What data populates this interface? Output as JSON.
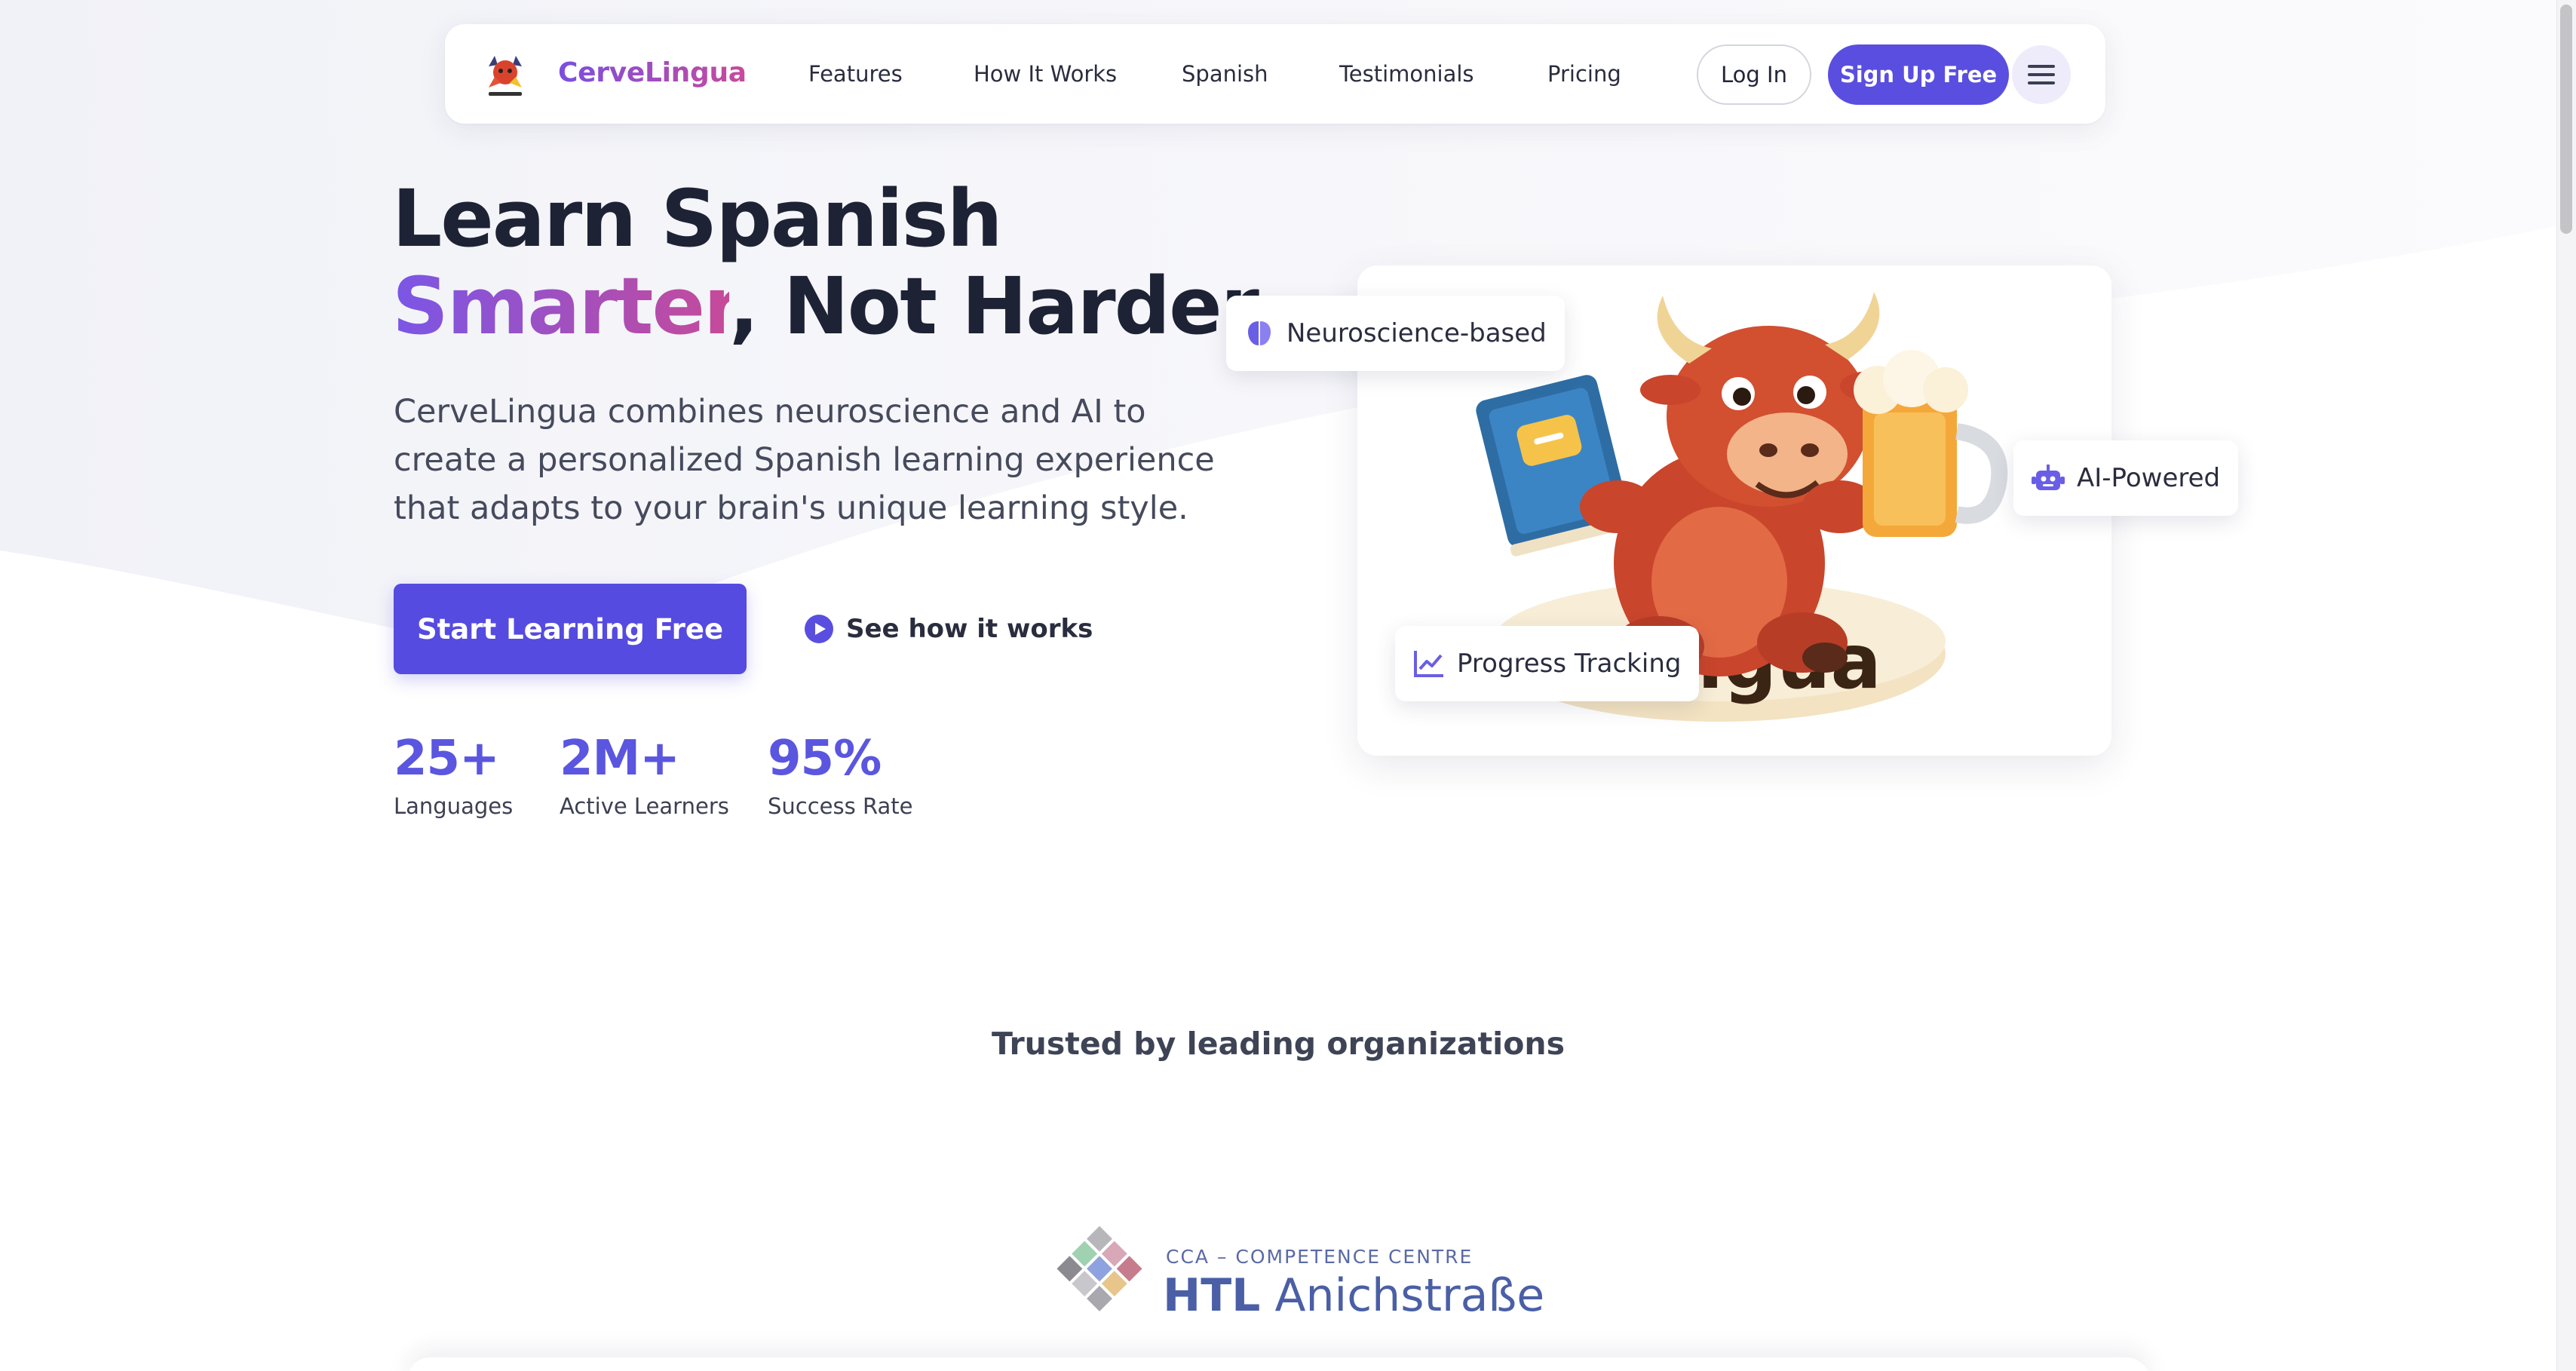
{
  "brand": {
    "name": "CerveLingua",
    "colors": {
      "primary": "#554be0",
      "gradient_start": "#7a56e6",
      "gradient_end": "#c64a9a"
    }
  },
  "nav": {
    "links": [
      "Features",
      "How It Works",
      "Spanish",
      "Testimonials",
      "Pricing"
    ],
    "login_label": "Log In",
    "signup_label": "Sign Up Free",
    "menu_icon": "hamburger-icon"
  },
  "hero": {
    "title_line1": "Learn Spanish",
    "title_accent": "Smarter",
    "title_rest": ", Not Harder",
    "description": "CerveLingua combines neuroscience and AI to create a personalized Spanish learning experience that adapts to your brain's unique learning style.",
    "cta_primary": "Start Learning Free",
    "cta_secondary": "See how it works",
    "stats": [
      {
        "value": "25+",
        "label": "Languages"
      },
      {
        "value": "2M+",
        "label": "Active Learners"
      },
      {
        "value": "95%",
        "label": "Success Rate"
      }
    ],
    "image_text": "eLingua",
    "badges": {
      "neuroscience": {
        "label": "Neuroscience-based",
        "icon": "brain-icon"
      },
      "ai": {
        "label": "AI-Powered",
        "icon": "robot-icon"
      },
      "progress": {
        "label": "Progress Tracking",
        "icon": "chart-line-icon"
      }
    }
  },
  "trusted": {
    "title": "Trusted by leading organizations",
    "partner": {
      "subtitle": "CCA – COMPETENCE CENTRE",
      "name_bold": "HTL",
      "name_rest": "Anichstraße"
    }
  }
}
